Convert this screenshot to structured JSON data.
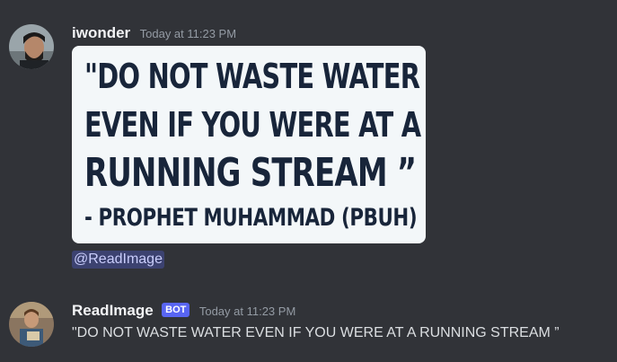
{
  "messages": [
    {
      "username": "iwonder",
      "timestamp": "Today at 11:23 PM",
      "image_text": {
        "line1": "\"DO NOT WASTE WATER",
        "line2": "EVEN IF YOU WERE AT A",
        "line3": "RUNNING STREAM ”",
        "line4": "- PROPHET MUHAMMAD (PBUH)"
      },
      "mention": "@ReadImage"
    },
    {
      "username": "ReadImage",
      "badge": "BOT",
      "timestamp": "Today at 11:23 PM",
      "text": "\"DO NOT WASTE WATER EVEN IF YOU WERE AT A RUNNING STREAM ”"
    }
  ],
  "colors": {
    "background": "#313338",
    "mention_bg": "#3c4270",
    "badge": "#5865f2"
  }
}
